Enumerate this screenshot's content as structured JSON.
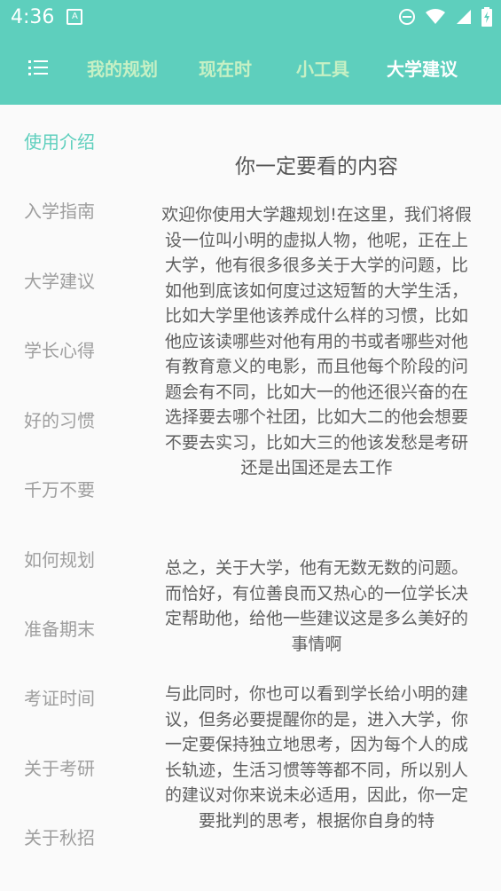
{
  "status_bar": {
    "time": "4:36",
    "notification_glyph": "A"
  },
  "toolbar": {
    "tabs": [
      {
        "label": "我的规划"
      },
      {
        "label": "现在时"
      },
      {
        "label": "小工具"
      },
      {
        "label": "大学建议",
        "active": true
      }
    ]
  },
  "sidebar": {
    "items": [
      {
        "label": "使用介绍",
        "active": true
      },
      {
        "label": "入学指南"
      },
      {
        "label": "大学建议"
      },
      {
        "label": "学长心得"
      },
      {
        "label": "好的习惯"
      },
      {
        "label": "千万不要"
      },
      {
        "label": "如何规划"
      },
      {
        "label": "准备期末"
      },
      {
        "label": "考证时间"
      },
      {
        "label": "关于考研"
      },
      {
        "label": "关于秋招"
      }
    ]
  },
  "content": {
    "title": "你一定要看的内容",
    "paragraphs": [
      "欢迎你使用大学趣规划!在这里，我们将假设一位叫小明的虚拟人物，他呢，正在上大学，他有很多很多关于大学的问题，比如他到底该如何度过这短暂的大学生活，比如大学里他该养成什么样的习惯，比如他应该读哪些对他有用的书或者哪些对他有教育意义的电影，而且他每个阶段的问题会有不同，比如大一的他还很兴奋的在选择要去哪个社团，比如大二的他会想要不要去实习，比如大三的他该发愁是考研还是出国还是去工作",
      "总之，关于大学，他有无数无数的问题。而恰好，有位善良而又热心的一位学长决定帮助他，给他一些建议这是多么美好的事情啊",
      "与此同时，你也可以看到学长给小明的建议，但务必要提醒你的是，进入大学，你一定要保持独立地思考，因为每个人的成长轨迹，生活习惯等等都不同，所以别人的建议对你来说未必适用，因此，你一定要批判的思考，根据你自身的特"
    ]
  },
  "colors": {
    "accent": "#5ecfbd",
    "tab_inactive": "#c6f0c4",
    "sidebar_text": "#9e9e9e"
  }
}
